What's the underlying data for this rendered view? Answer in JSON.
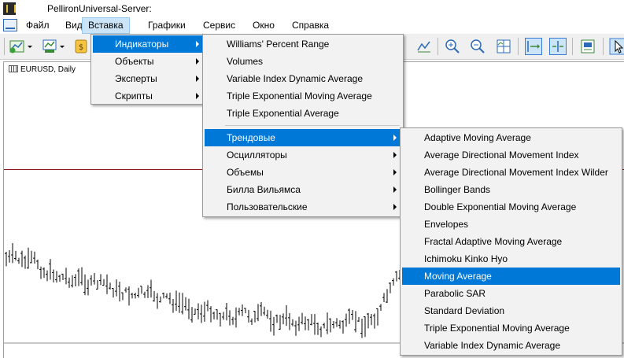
{
  "title": "PellironUniversal-Server:",
  "menubar": {
    "items": [
      "Файл",
      "Вид",
      "Вставка",
      "Графики",
      "Сервис",
      "Окно",
      "Справка"
    ]
  },
  "chart": {
    "symbol_label": "EURUSD, Daily"
  },
  "insert_menu": {
    "items": [
      "Индикаторы",
      "Объекты",
      "Эксперты",
      "Скрипты"
    ]
  },
  "indicators_menu": {
    "recent": [
      "Williams' Percent Range",
      "Volumes",
      "Variable Index Dynamic Average",
      "Triple Exponential Moving Average",
      "Triple Exponential Average"
    ],
    "groups": [
      "Трендовые",
      "Осцилляторы",
      "Объемы",
      "Билла Вильямса",
      "Пользовательские"
    ]
  },
  "trend_menu": {
    "items": [
      "Adaptive Moving Average",
      "Average Directional Movement Index",
      "Average Directional Movement Index Wilder",
      "Bollinger Bands",
      "Double Exponential Moving Average",
      "Envelopes",
      "Fractal Adaptive Moving Average",
      "Ichimoku Kinko Hyo",
      "Moving Average",
      "Parabolic SAR",
      "Standard Deviation",
      "Triple Exponential Moving Average",
      "Variable Index Dynamic Average"
    ]
  },
  "colors": {
    "highlight": "#0078d7",
    "menu_bg": "#f2f2f2",
    "active_menubar": "#cce4f7",
    "level_line": "#8b1a1a"
  }
}
